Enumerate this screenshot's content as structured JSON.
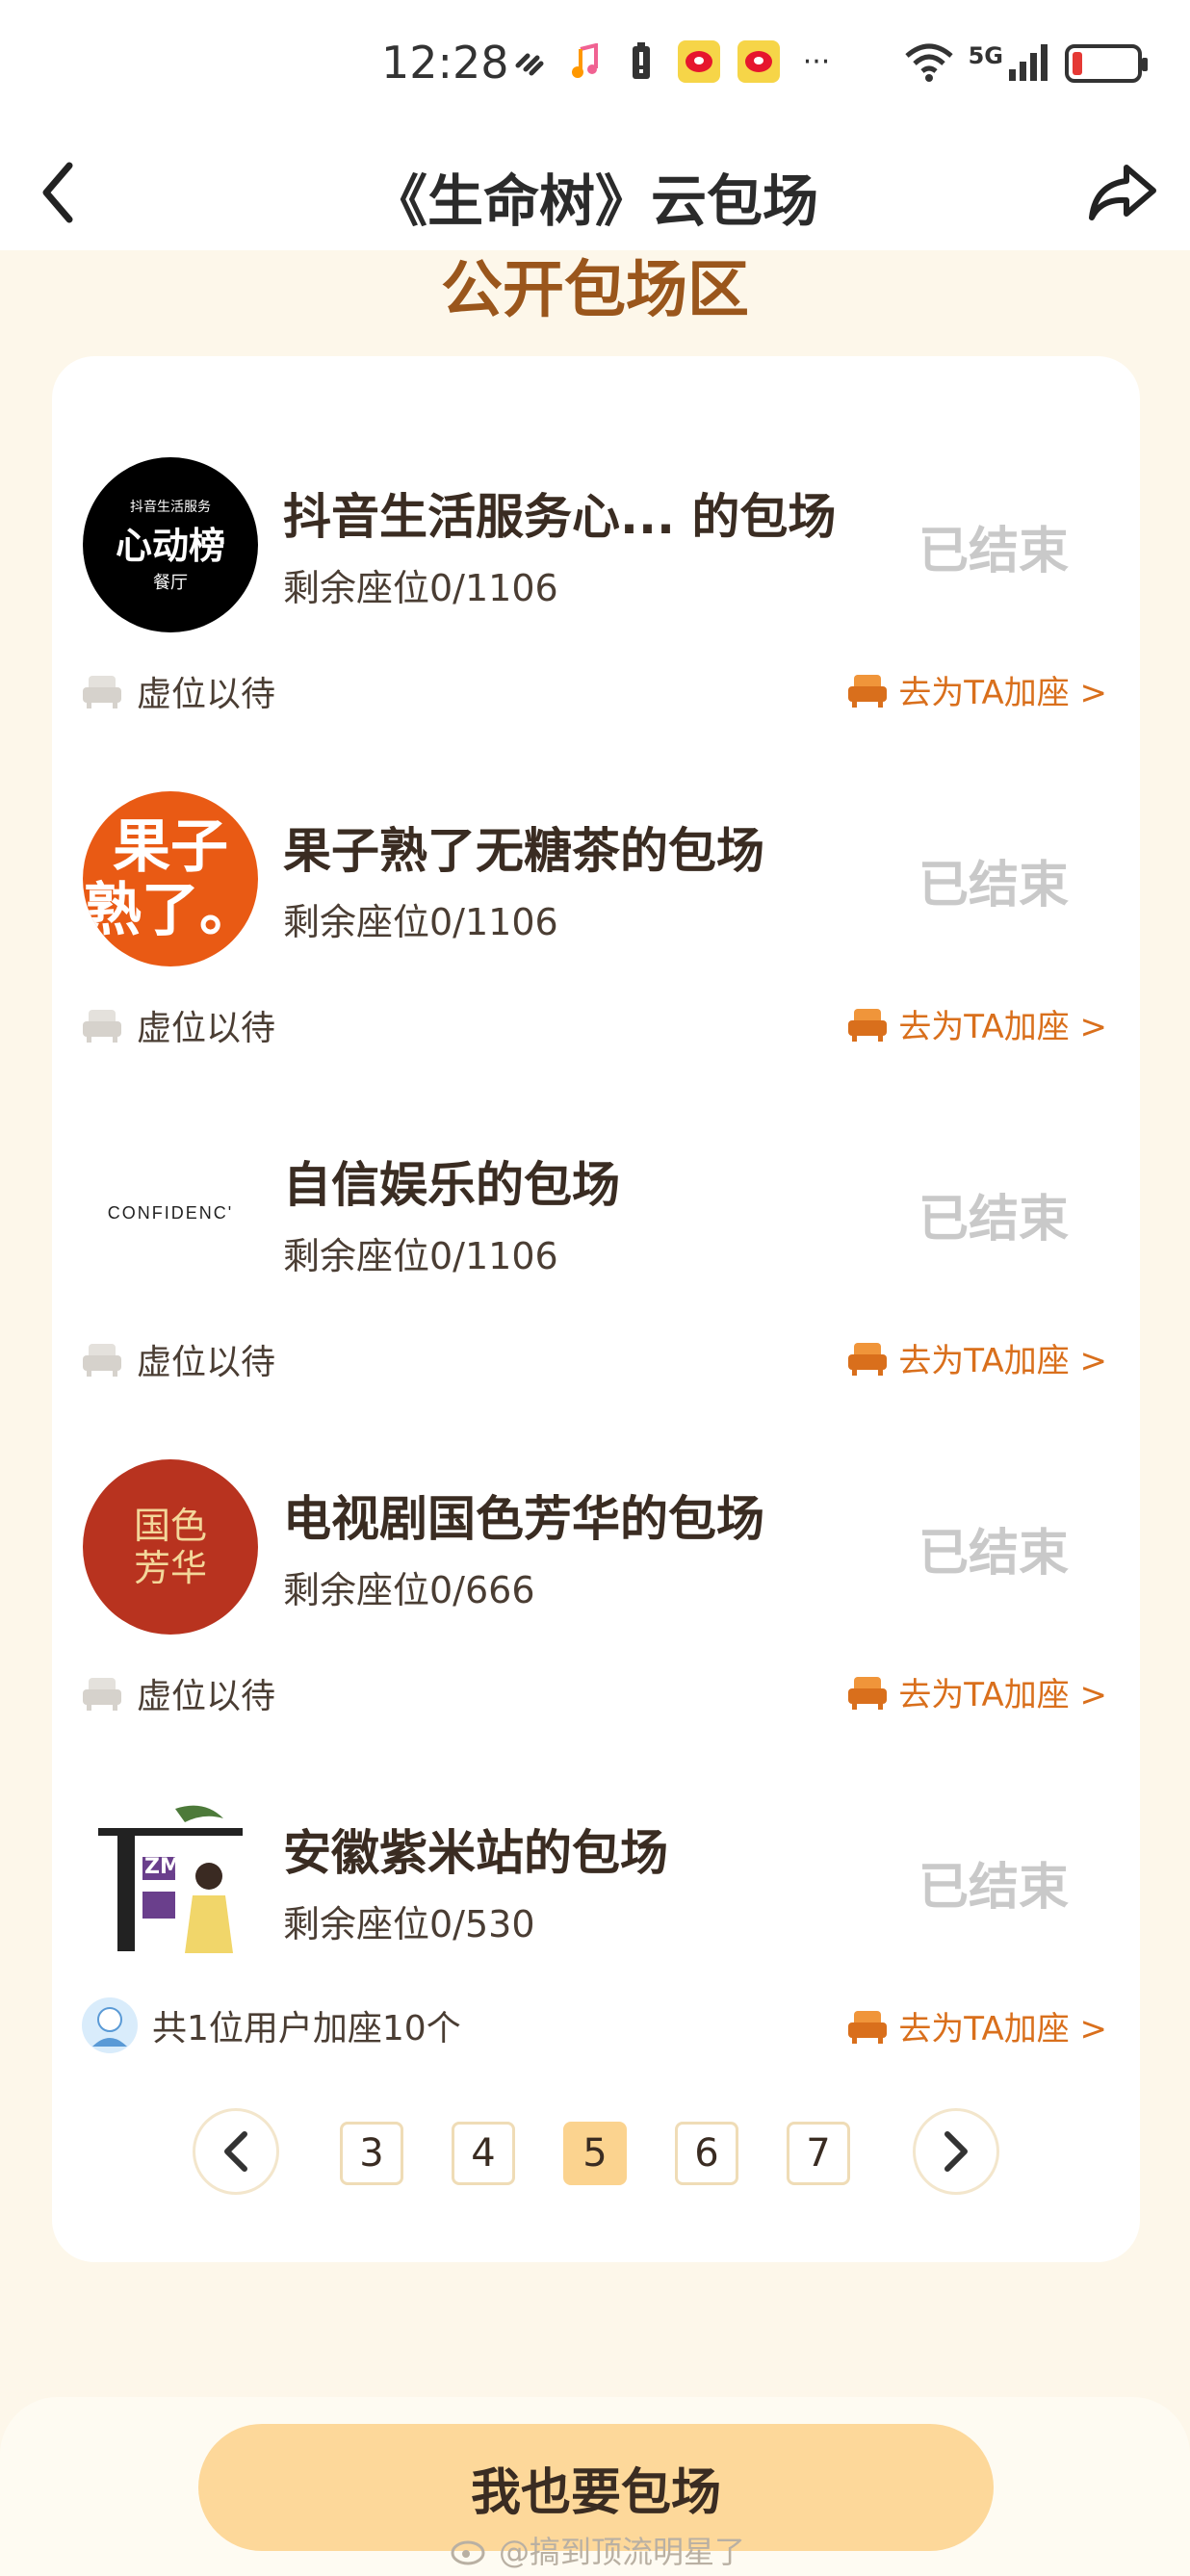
{
  "status_bar": {
    "time": "12:28",
    "network": "5G",
    "more": "···"
  },
  "header": {
    "title": "《生命树》云包场"
  },
  "section": {
    "heading": "公开包场区"
  },
  "entries": [
    {
      "name": "抖音生活服务心... 的包场",
      "seats": "剩余座位0/1106",
      "status": "已结束",
      "foot_left": "虚位以待",
      "foot_right": "去为TA加座 >",
      "logo_small": "抖音生活服务",
      "logo_main": "心动榜",
      "logo_sub": "餐厅"
    },
    {
      "name": "果子熟了无糖茶的包场",
      "seats": "剩余座位0/1106",
      "status": "已结束",
      "foot_left": "虚位以待",
      "foot_right": "去为TA加座 >",
      "logo_line1": "果子",
      "logo_line2": "熟了。"
    },
    {
      "name": "自信娱乐的包场",
      "seats": "剩余座位0/1106",
      "status": "已结束",
      "foot_left": "虚位以待",
      "foot_right": "去为TA加座 >",
      "logo_text": "CONFIDENC'"
    },
    {
      "name": "电视剧国色芳华的包场",
      "seats": "剩余座位0/666",
      "status": "已结束",
      "foot_left": "虚位以待",
      "foot_right": "去为TA加座 >",
      "logo_text": "国色芳华"
    },
    {
      "name": "安徽紫米站的包场",
      "seats": "剩余座位0/530",
      "status": "已结束",
      "foot_left": "共1位用户加座10个",
      "foot_right": "去为TA加座 >",
      "logo_text": "ZM"
    }
  ],
  "pagination": {
    "pages": [
      "3",
      "4",
      "5",
      "6",
      "7"
    ],
    "current": "5"
  },
  "cta": {
    "label": "我也要包场"
  },
  "watermark": {
    "text": "@搞到顶流明星了"
  },
  "colors": {
    "page_bg": "#fdf7ea",
    "heading": "#9a561c",
    "accent": "#d96f1c",
    "cta_bg": "#fdd89a",
    "status_ended": "#c9c9c9"
  }
}
